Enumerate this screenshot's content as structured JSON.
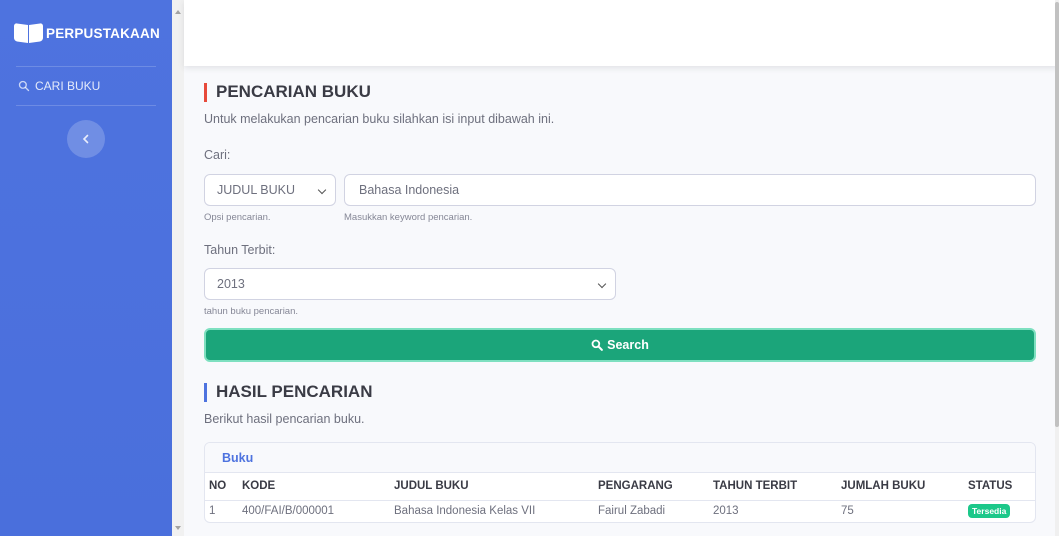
{
  "sidebar": {
    "brand": "PERPUSTAKAAN",
    "items": [
      {
        "label": "CARI BUKU",
        "icon": "search-icon"
      }
    ],
    "toggle_icon": "chevron-left-icon"
  },
  "search_section": {
    "title": "PENCARIAN BUKU",
    "description": "Untuk melakukan pencarian buku silahkan isi input dibawah ini.",
    "cari_label": "Cari:",
    "option_select": "JUDUL BUKU",
    "option_help": "Opsi pencarian.",
    "keyword_value": "Bahasa Indonesia",
    "keyword_help": "Masukkan keyword pencarian.",
    "year_label": "Tahun Terbit:",
    "year_value": "2013",
    "year_help": "tahun buku pencarian.",
    "search_button": "Search"
  },
  "results_section": {
    "title": "HASIL PENCARIAN",
    "description": "Berikut hasil pencarian buku.",
    "card_title": "Buku",
    "columns": [
      "NO",
      "KODE",
      "JUDUL BUKU",
      "PENGARANG",
      "TAHUN TERBIT",
      "JUMLAH BUKU",
      "STATUS"
    ],
    "rows": [
      {
        "no": "1",
        "kode": "400/FAI/B/000001",
        "judul": "Bahasa Indonesia Kelas VII",
        "pengarang": "Fairul Zabadi",
        "tahun": "2013",
        "jumlah": "75",
        "status": "Tersedia"
      }
    ]
  },
  "colors": {
    "sidebar": "#4e73df",
    "accent_red": "#e74a3b",
    "accent_blue": "#4e73df",
    "search_button": "#1ba57a",
    "badge_success": "#1cc88a"
  }
}
